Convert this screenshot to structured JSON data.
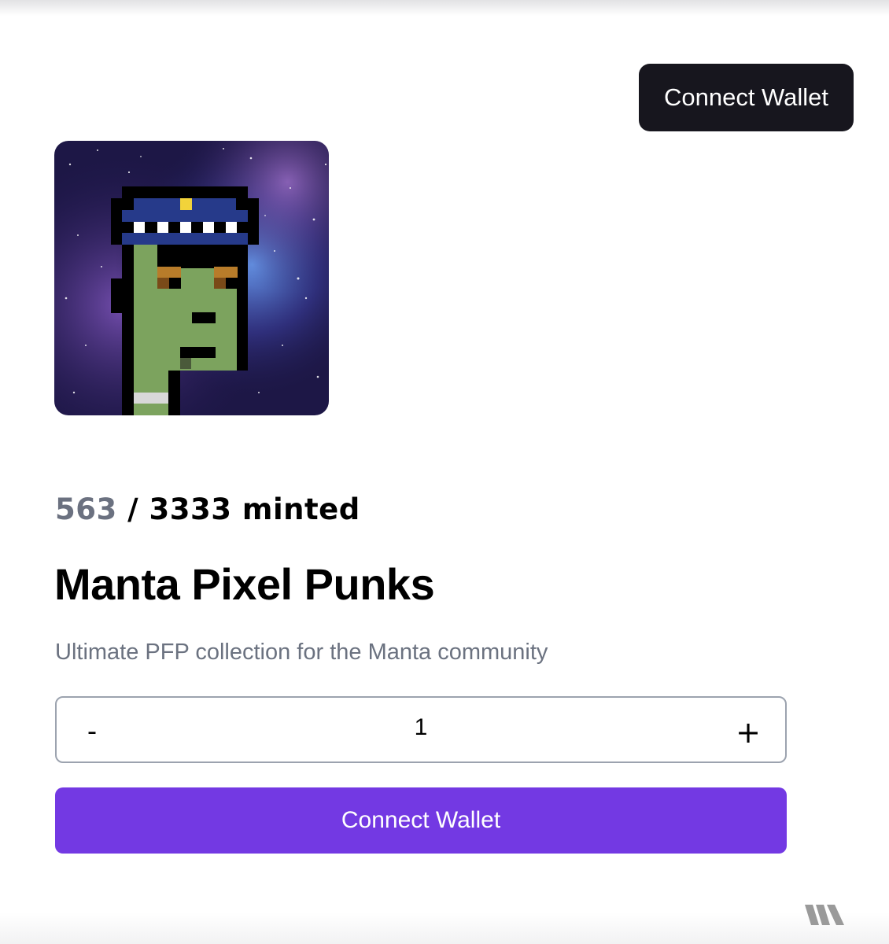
{
  "header": {
    "connect_label": "Connect Wallet",
    "connect_bg": "#17161e"
  },
  "collection": {
    "image_icon": "pixel-punk-avatar",
    "minted": "563",
    "separator": "/",
    "total_label": "3333 minted",
    "title": "Manta Pixel Punks",
    "description": "Ultimate PFP collection for the Manta community"
  },
  "quantity": {
    "decrement_label": "-",
    "value": "1",
    "increment_label": "+"
  },
  "mint_button": {
    "label": "Connect Wallet",
    "bg": "#7339e3"
  },
  "footer": {
    "logo_icon": "brand-logo-icon"
  }
}
